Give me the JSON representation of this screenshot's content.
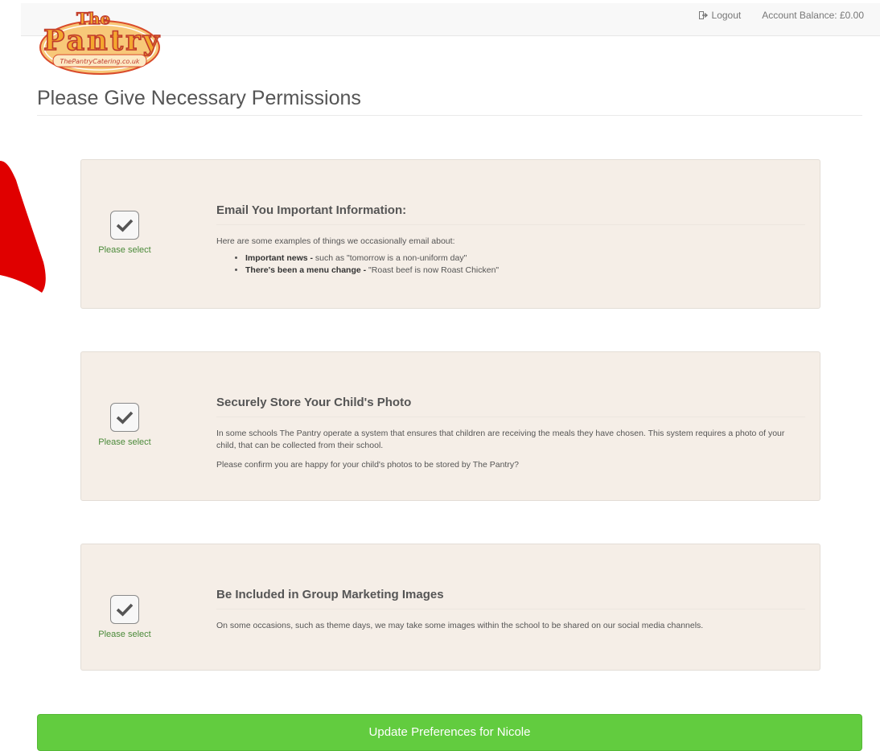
{
  "header": {
    "logout_label": "Logout",
    "account_balance": "Account Balance: £0.00"
  },
  "logo": {
    "line1": "The",
    "line2": "Pantry",
    "tagline": "ThePantryCatering.co.uk"
  },
  "page": {
    "title": "Please Give Necessary Permissions"
  },
  "permissions": [
    {
      "checked": true,
      "check_label": "Please select",
      "heading": "Email You Important Information:",
      "intro": "Here are some examples of things we occasionally email about:",
      "examples": [
        {
          "bold": "Important news -",
          "text": " such as \"tomorrow is a non-uniform day\""
        },
        {
          "bold": "There's been a menu change -",
          "text": " \"Roast beef is now Roast Chicken\""
        }
      ]
    },
    {
      "checked": true,
      "check_label": "Please select",
      "heading": "Securely Store Your Child's Photo",
      "text1": "In some schools The Pantry operate a system that ensures that children are receiving the meals they have chosen. This system requires a photo of your child, that can be collected from their school.",
      "text2": "Please confirm you are happy for your child's photos to be stored by The Pantry?"
    },
    {
      "checked": true,
      "check_label": "Please select",
      "heading": "Be Included in Group Marketing Images",
      "text1": "On some occasions, such as theme days, we may take some images within the school to be shared on our social media channels."
    }
  ],
  "actions": {
    "update_label": "Update Preferences for Nicole"
  },
  "colors": {
    "card_bg": "#f5eee7",
    "button_green": "#62cc3f",
    "label_green": "#4b8a3a",
    "annotation_red": "#e00000"
  }
}
